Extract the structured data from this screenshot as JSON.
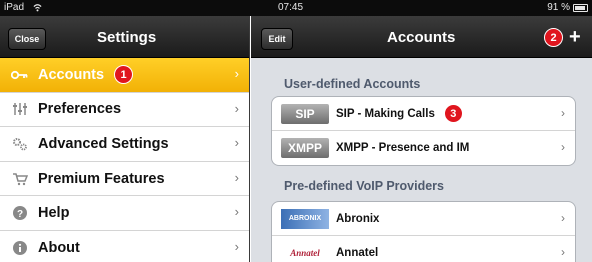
{
  "status_bar": {
    "device": "iPad",
    "time": "07:45",
    "battery": "91 %"
  },
  "master": {
    "close_label": "Close",
    "title": "Settings",
    "items": [
      {
        "label": "Accounts",
        "icon": "key-icon",
        "badge": "1",
        "selected": true
      },
      {
        "label": "Preferences",
        "icon": "sliders-icon"
      },
      {
        "label": "Advanced Settings",
        "icon": "gears-icon"
      },
      {
        "label": "Premium Features",
        "icon": "cart-icon"
      },
      {
        "label": "Help",
        "icon": "help-icon"
      },
      {
        "label": "About",
        "icon": "info-icon"
      }
    ]
  },
  "detail": {
    "edit_label": "Edit",
    "title": "Accounts",
    "add_badge": "2",
    "add_label": "+",
    "user_section": "User-defined Accounts",
    "user_accounts": [
      {
        "protocol": "SIP",
        "label": "SIP - Making Calls",
        "badge": "3"
      },
      {
        "protocol": "XMPP",
        "label": "XMPP - Presence and IM"
      }
    ],
    "provider_section": "Pre-defined VoIP Providers",
    "providers": [
      {
        "logo_text": "ABRONIX",
        "label": "Abronix"
      },
      {
        "logo_text": "Annatel",
        "label": "Annatel"
      }
    ]
  },
  "colors": {
    "selected_row": "#f5b80d",
    "badge": "#e0151e",
    "detail_bg": "#dcdfe4"
  }
}
